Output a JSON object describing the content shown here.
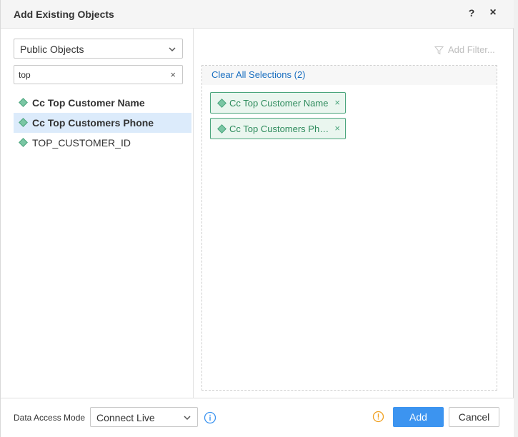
{
  "dialog": {
    "title": "Add Existing Objects",
    "help_symbol": "?",
    "close_symbol": "×"
  },
  "left": {
    "source_select": {
      "value": "Public Objects"
    },
    "search": {
      "value": "top",
      "clear_symbol": "×"
    },
    "items": [
      {
        "label": "Cc Top Customer Name",
        "bold": true,
        "selected": false
      },
      {
        "label": "Cc Top Customers Phone",
        "bold": true,
        "selected": true
      },
      {
        "label": "TOP_CUSTOMER_ID",
        "bold": false,
        "selected": false
      }
    ]
  },
  "right": {
    "add_filter_label": "Add Filter...",
    "clear_all_label": "Clear All Selections (2)",
    "chips": [
      {
        "label": "Cc Top Customer Name",
        "remove_symbol": "×"
      },
      {
        "label": "Cc Top Customers Ph…",
        "remove_symbol": "×"
      }
    ]
  },
  "footer": {
    "data_access_label": "Data Access Mode",
    "mode_select": {
      "value": "Connect Live"
    },
    "add_label": "Add",
    "cancel_label": "Cancel"
  },
  "colors": {
    "accent": "#3c94f0",
    "link": "#1a6fc0",
    "object_green": "#4aa57c",
    "warning": "#f0a020"
  },
  "icons": {
    "help": "help-icon",
    "close": "close-icon",
    "chevron": "chevron-down-icon",
    "filter": "filter-icon",
    "info": "info-icon",
    "warning": "warning-icon",
    "object": "diamond-icon"
  }
}
